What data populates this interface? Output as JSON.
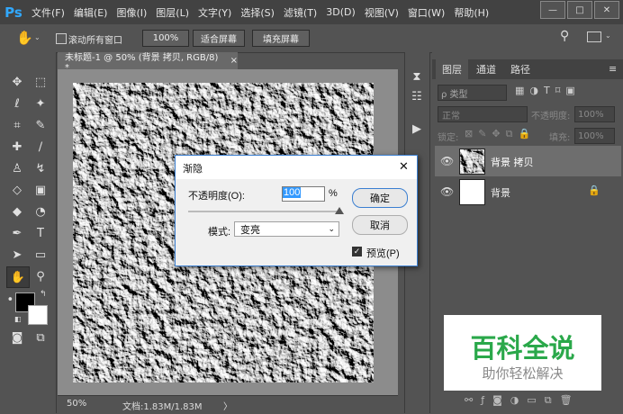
{
  "app": {
    "logo": "Ps"
  },
  "menu": [
    "文件(F)",
    "编辑(E)",
    "图像(I)",
    "图层(L)",
    "文字(Y)",
    "选择(S)",
    "滤镜(T)",
    "3D(D)",
    "视图(V)",
    "窗口(W)",
    "帮助(H)"
  ],
  "window_controls": {
    "minimize": "—",
    "restore": "□",
    "close": "✕"
  },
  "options": {
    "scroll_all_label": "滚动所有窗口",
    "zoom_100": "100%",
    "fit_screen": "适合屏幕",
    "fill_screen": "填充屏幕"
  },
  "document": {
    "tab_title": "未标题-1 @ 50% (背景 拷贝, RGB/8) *",
    "close_glyph": "×",
    "zoom": "50%",
    "doc_info": "文档:1.83M/1.83M",
    "arrow": "〉"
  },
  "panels": {
    "tabs": [
      "图层",
      "通道",
      "路径"
    ],
    "filter_label": "ρ 类型",
    "blend_mode": "正常",
    "opacity_label": "不透明度:",
    "opacity_value": "100%",
    "lock_label": "锁定:",
    "fill_label": "填充:",
    "fill_value": "100%",
    "layers": [
      {
        "name": "背景 拷贝",
        "selected": true
      },
      {
        "name": "背景",
        "selected": false
      }
    ]
  },
  "dialog": {
    "title": "渐隐",
    "opacity_label": "不透明度(O):",
    "opacity_value": "100",
    "percent": "%",
    "slider_value": 1.0,
    "mode_label": "模式:",
    "mode_value": "变亮",
    "ok": "确定",
    "cancel": "取消",
    "preview": "预览(P)",
    "preview_checked": true
  },
  "watermark": {
    "title": "百科全说",
    "subtitle": "助你轻松解决"
  },
  "colors": {
    "accent": "#31a8ff",
    "watermark_green": "#2aa84a",
    "dialog_border": "#3b7fd1"
  }
}
